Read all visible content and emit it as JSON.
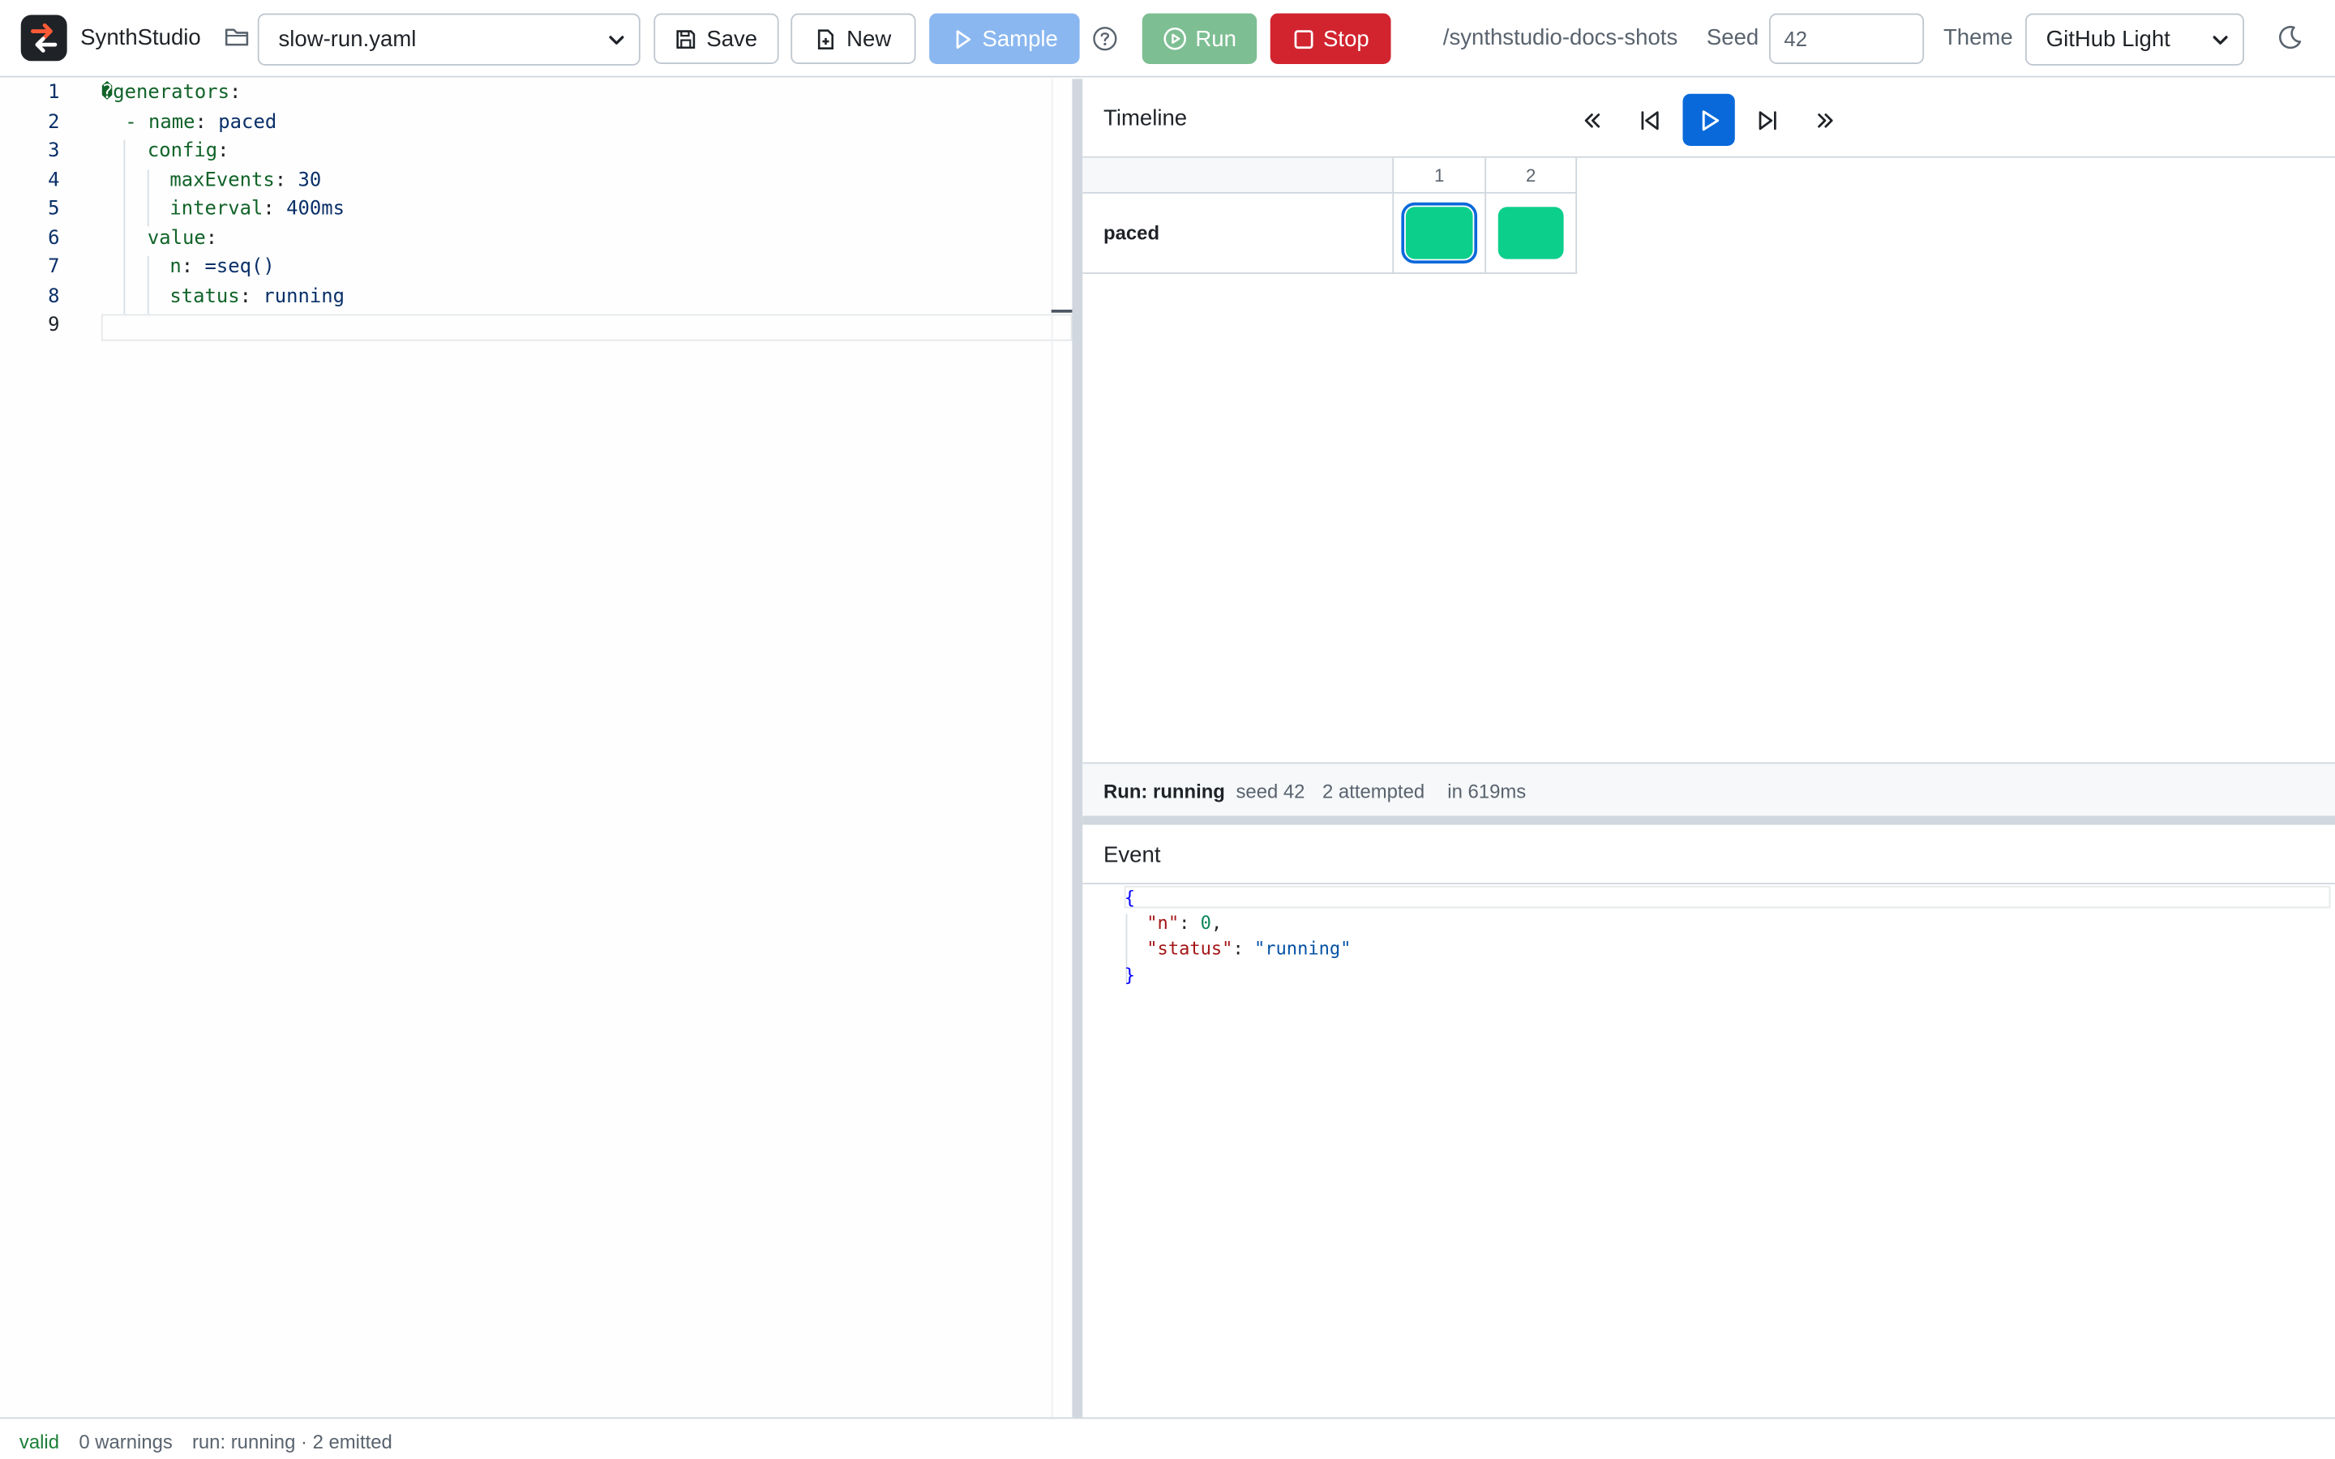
{
  "app": {
    "name": "SynthStudio"
  },
  "toolbar": {
    "file_selected": "slow-run.yaml",
    "save_label": "Save",
    "new_label": "New",
    "sample_label": "Sample",
    "run_label": "Run",
    "stop_label": "Stop",
    "path": "/synthstudio-docs-shots",
    "seed_label": "Seed",
    "seed_value": "42",
    "theme_label": "Theme",
    "theme_selected": "GitHub Light",
    "icons": [
      "folder-icon",
      "save-icon",
      "new-file-icon",
      "play-icon",
      "help-icon",
      "run-icon",
      "stop-icon",
      "moon-icon"
    ]
  },
  "editor": {
    "line_numbers": [
      "1",
      "2",
      "3",
      "4",
      "5",
      "6",
      "7",
      "8",
      "9"
    ],
    "lines": [
      {
        "key": "�generators",
        "sep": ":",
        "value": ""
      },
      {
        "key": "- name",
        "sep": ": ",
        "value": "paced"
      },
      {
        "key": "config",
        "sep": ":",
        "value": ""
      },
      {
        "key": "maxEvents",
        "sep": ": ",
        "value": "30"
      },
      {
        "key": "interval",
        "sep": ": ",
        "value": "400ms"
      },
      {
        "key": "value",
        "sep": ":",
        "value": ""
      },
      {
        "key": "n",
        "sep": ": ",
        "value": "=seq()"
      },
      {
        "key": "status",
        "sep": ": ",
        "value": "running"
      },
      {
        "key": "",
        "sep": "",
        "value": ""
      }
    ]
  },
  "timeline": {
    "title": "Timeline",
    "controls": [
      "rewind-icon",
      "step-back-icon",
      "play-icon",
      "step-forward-icon",
      "fast-forward-icon"
    ],
    "columns": [
      "1",
      "2"
    ],
    "rows": [
      {
        "label": "paced",
        "events": [
          {
            "color": "#0dcf8c",
            "selected": true
          },
          {
            "color": "#0dcf8c",
            "selected": false
          }
        ]
      }
    ],
    "status": {
      "run": "Run: running",
      "seed": "seed 42",
      "attempted": "2 attempted",
      "time": "in 619ms"
    }
  },
  "event": {
    "title": "Event",
    "json_lines": [
      {
        "indent": 0,
        "text": "{"
      },
      {
        "indent": 1,
        "key": "\"n\"",
        "value": "0",
        "type": "number",
        "trail": ","
      },
      {
        "indent": 1,
        "key": "\"status\"",
        "value": "\"running\"",
        "type": "string",
        "trail": ""
      },
      {
        "indent": 0,
        "text": "}"
      }
    ]
  },
  "footer": {
    "valid": "valid",
    "warnings": "0 warnings",
    "run": "run: running · 2 emitted"
  },
  "colors": {
    "accent": "#0969da",
    "run": "#7dbe93",
    "stop": "#d1242f",
    "sample": "#8ab7f0",
    "event": "#0dcf8c",
    "valid": "#1a7f37"
  }
}
